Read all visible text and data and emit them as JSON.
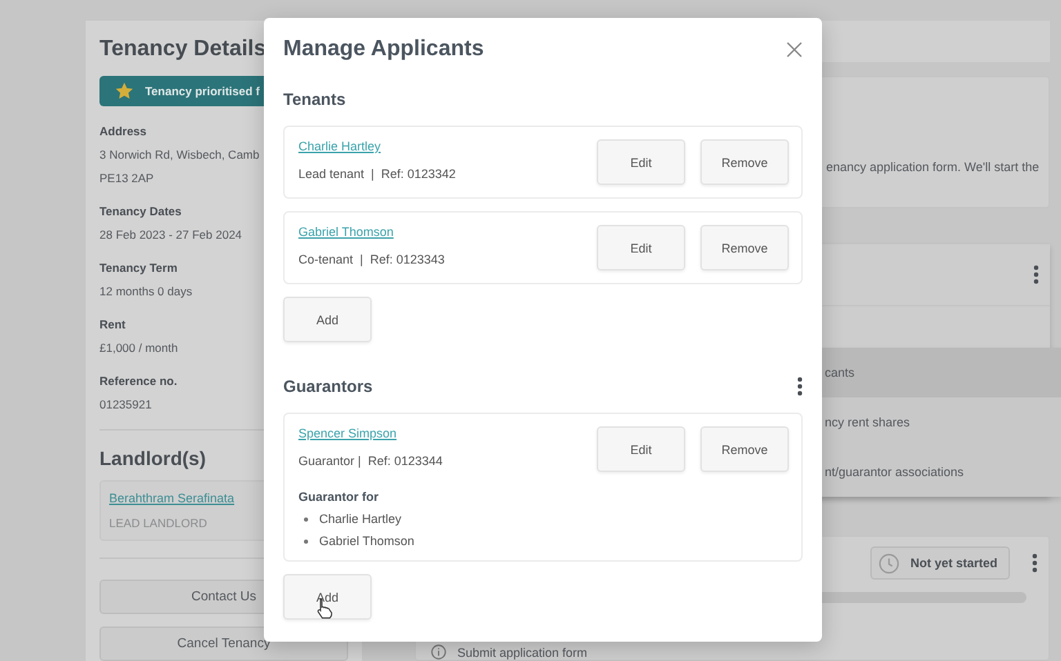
{
  "tenancy_details": {
    "title": "Tenancy Details",
    "banner": "Tenancy prioritised f",
    "fields": [
      {
        "label": "Address",
        "lines": [
          "3 Norwich Rd, Wisbech, Camb",
          "PE13 2AP"
        ]
      },
      {
        "label": "Tenancy Dates",
        "lines": [
          "28 Feb 2023 - 27 Feb 2024"
        ]
      },
      {
        "label": "Tenancy Term",
        "lines": [
          "12 months 0 days"
        ]
      },
      {
        "label": "Rent",
        "lines": [
          "£1,000 / month"
        ]
      },
      {
        "label": "Reference no.",
        "lines": [
          "01235921"
        ]
      }
    ],
    "landlords_title": "Landlord(s)",
    "landlords": [
      {
        "name": "Berahthram Serafinata",
        "role": "LEAD LANDLORD"
      }
    ],
    "buttons": [
      "Contact Us",
      "Cancel Tenancy"
    ]
  },
  "background": {
    "notice": "enancy application form. We'll start the",
    "menu": [
      {
        "label": "cants",
        "highlighted": true
      },
      {
        "label": "ncy rent shares",
        "highlighted": false
      },
      {
        "label": "nt/guarantor associations",
        "highlighted": false
      }
    ],
    "status": "Not yet started",
    "progress": {
      "level": 0
    },
    "step": "Submit application form"
  },
  "modal": {
    "title": "Manage Applicants",
    "sections": [
      {
        "title": "Tenants",
        "has_menu": false,
        "applicants": [
          {
            "name": "Charlie Hartley",
            "detail": "Lead tenant  |  Ref: 0123342",
            "buttons": [
              "Edit",
              "Remove"
            ]
          },
          {
            "name": "Gabriel Thomson",
            "detail": "Co-tenant  |  Ref: 0123343",
            "buttons": [
              "Edit",
              "Remove"
            ]
          }
        ],
        "add_button": "Add",
        "pointer": false
      },
      {
        "title": "Guarantors",
        "has_menu": true,
        "applicants": [
          {
            "name": "Spencer Simpson",
            "detail": "Guarantor |  Ref: 0123344",
            "buttons": [
              "Edit",
              "Remove"
            ],
            "guarantor_for_label": "Guarantor for",
            "guarantor_for": [
              "Charlie Hartley",
              "Gabriel Thomson"
            ]
          }
        ],
        "add_button": "Add",
        "pointer": true
      }
    ]
  }
}
